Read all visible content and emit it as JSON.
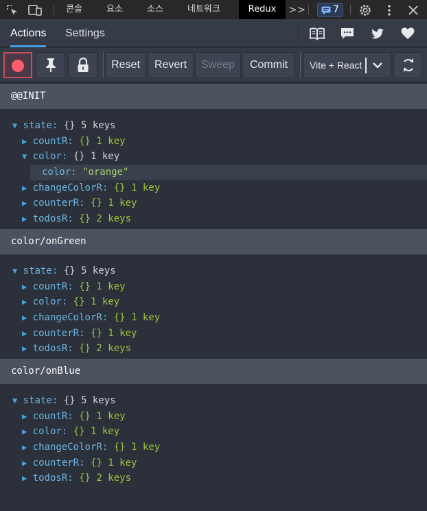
{
  "devtools": {
    "tabs": [
      "콘솔",
      "요소",
      "소스",
      "네트워크",
      "Redux"
    ],
    "active_tab": "Redux",
    "overflow_label": ">>",
    "issues_count": "7"
  },
  "redux": {
    "tabs": [
      "Actions",
      "Settings"
    ],
    "active_tab": "Actions"
  },
  "toolbar": {
    "reset": "Reset",
    "revert": "Revert",
    "sweep": "Sweep",
    "commit": "Commit",
    "instance": "Vite + React"
  },
  "colors": {
    "accent": "#4c9fe0",
    "record": "#ff5c6c",
    "key": "#6cb8e6",
    "value_green": "#9bc53d"
  },
  "actions": [
    {
      "name": "@@INIT",
      "state_label": "state:",
      "state_braces": "{}",
      "state_count": "5 keys",
      "children": [
        {
          "key": "countR:",
          "braces": "{}",
          "count": "1 key",
          "expanded": false
        },
        {
          "key": "color:",
          "braces": "{}",
          "count": "1 key",
          "expanded": true,
          "child": {
            "key": "color:",
            "value": "\"orange\""
          }
        },
        {
          "key": "changeColorR:",
          "braces": "{}",
          "count": "1 key",
          "expanded": false
        },
        {
          "key": "counterR:",
          "braces": "{}",
          "count": "1 key",
          "expanded": false
        },
        {
          "key": "todosR:",
          "braces": "{}",
          "count": "2 keys",
          "expanded": false
        }
      ]
    },
    {
      "name": "color/onGreen",
      "state_label": "state:",
      "state_braces": "{}",
      "state_count": "5 keys",
      "children": [
        {
          "key": "countR:",
          "braces": "{}",
          "count": "1 key"
        },
        {
          "key": "color:",
          "braces": "{}",
          "count": "1 key"
        },
        {
          "key": "changeColorR:",
          "braces": "{}",
          "count": "1 key"
        },
        {
          "key": "counterR:",
          "braces": "{}",
          "count": "1 key"
        },
        {
          "key": "todosR:",
          "braces": "{}",
          "count": "2 keys"
        }
      ]
    },
    {
      "name": "color/onBlue",
      "state_label": "state:",
      "state_braces": "{}",
      "state_count": "5 keys",
      "children": [
        {
          "key": "countR:",
          "braces": "{}",
          "count": "1 key"
        },
        {
          "key": "color:",
          "braces": "{}",
          "count": "1 key"
        },
        {
          "key": "changeColorR:",
          "braces": "{}",
          "count": "1 key"
        },
        {
          "key": "counterR:",
          "braces": "{}",
          "count": "1 key"
        },
        {
          "key": "todosR:",
          "braces": "{}",
          "count": "2 keys"
        }
      ]
    }
  ]
}
